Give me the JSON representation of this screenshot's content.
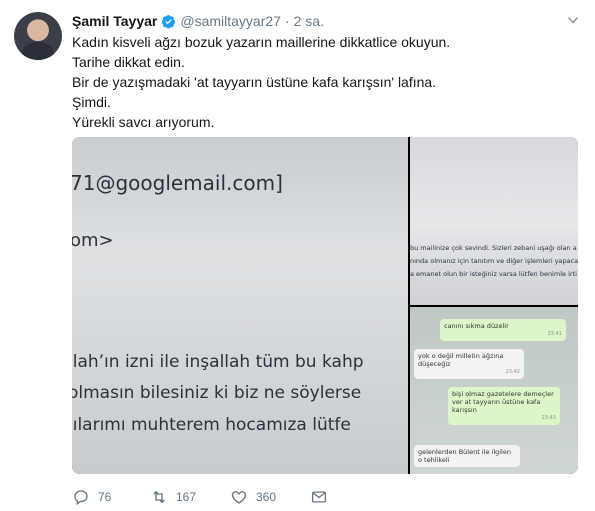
{
  "tweet": {
    "name": "Şamil Tayyar",
    "handle": "@samiltayyar27",
    "separator": "·",
    "time": "2 sa.",
    "lines": [
      "Kadın kisveli ağzı bozuk yazarın maillerine dikkatlice okuyun.",
      "Tarihe dikkat edin.",
      "Bir de yazışmadaki 'at tayyarın üstüne kafa karışsın' lafına.",
      "Şimdi.",
      "Yürekli savcı arıyorum."
    ]
  },
  "media": {
    "main_lines": [
      "71@googlemail.com]",
      "om>",
      "llah’ın izni ile inşallah tüm bu kahp",
      "olmasın bilesiniz ki biz ne söylerse",
      "ıılarımı muhterem hocamıza lütfe"
    ],
    "top_right_lines": [
      "bu mailinize çok sevindi. Sizleri zebani uşağı olan a",
      "nında olmanız için tanıtım ve diğer işlemleri yapaca",
      "a emanet olun bir isteğiniz varsa lütfen benimle irti"
    ],
    "chat": [
      {
        "text": "canını sıkma düzelir",
        "time": "23:41",
        "dir": "out"
      },
      {
        "text": "yok o değil milletin ağzına düşeceğiz",
        "time": "23:42",
        "dir": "in"
      },
      {
        "text": "bişi olmaz gazetelere demeçler ver at tayyarın üstüne kafa karışsın",
        "time": "23:43",
        "dir": "out"
      },
      {
        "text": "gelenlerden Bülent ile ilgilen o tehlikeli",
        "time": "",
        "dir": "in"
      }
    ]
  },
  "actions": {
    "replies": "76",
    "retweets": "167",
    "likes": "360"
  },
  "colors": {
    "accent": "#1da1f2",
    "muted": "#657786",
    "text": "#14171a"
  },
  "icons": [
    "verified-badge-icon",
    "caret-down-icon",
    "reply-icon",
    "retweet-icon",
    "like-icon",
    "message-icon"
  ]
}
